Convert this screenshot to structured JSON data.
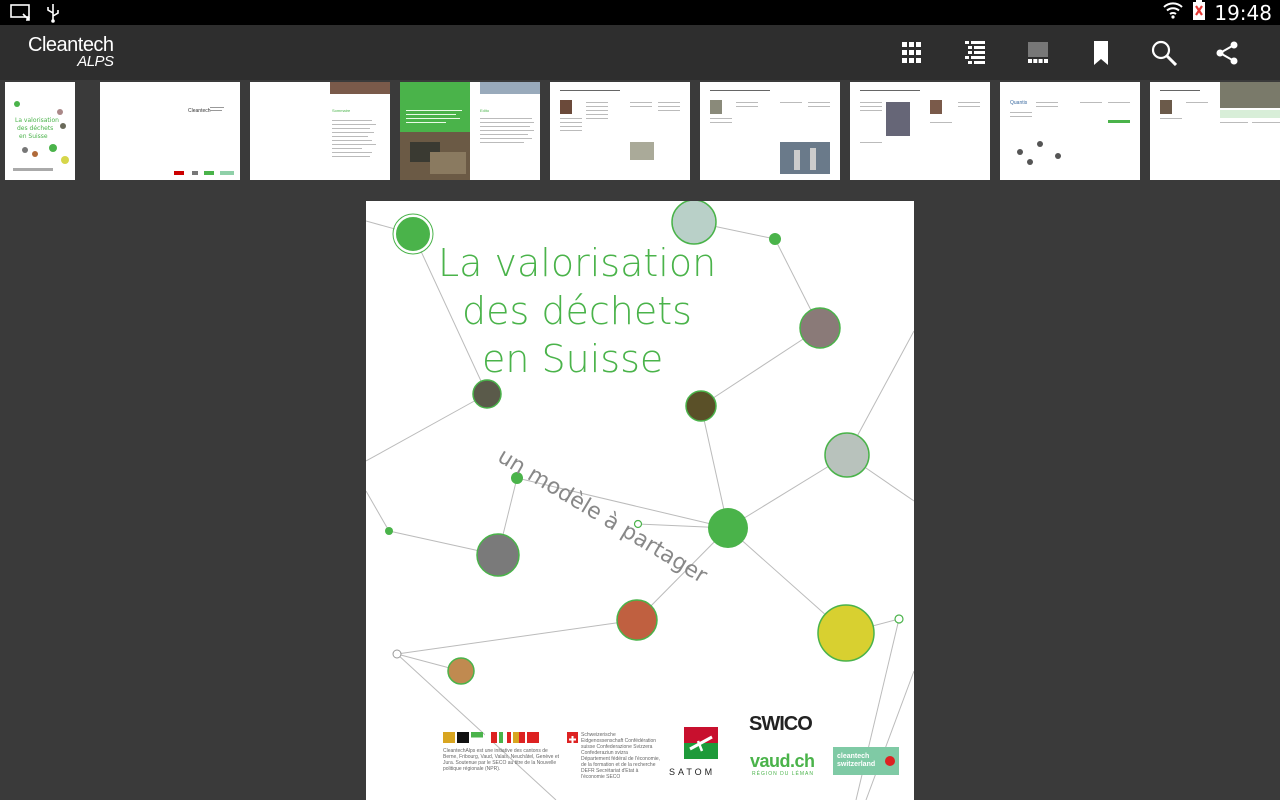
{
  "status": {
    "time": "19:48"
  },
  "app": {
    "logo_line1": "Cleantech",
    "logo_line2": "ALPS",
    "actions": [
      {
        "name": "grid-view-icon"
      },
      {
        "name": "outline-list-icon"
      },
      {
        "name": "page-layout-icon"
      },
      {
        "name": "bookmark-icon"
      },
      {
        "name": "search-icon"
      },
      {
        "name": "share-icon"
      }
    ]
  },
  "document": {
    "title_line1": "La valorisation",
    "title_line2": "des déchets",
    "title_line3": "en Suisse",
    "subtitle": "un modèle à partager",
    "footer": {
      "initiative": "CleantechAlps est une initiative des cantons de Berne, Fribourg, Vaud, Valais, Neuchâtel, Genève et Jura. Soutenue par le SECO au titre de la Nouvelle politique régionale (NPR).",
      "confed": "Schweizerische Eidgenossenschaft Confédération suisse Confederazione Svizzera Confederaziun svizra",
      "dept": "Département fédéral de l'économie, de la formation et de la recherche DEFR Secrétariat d'Etat à l'économie SECO",
      "satom": "SATOM",
      "swico": "SWICO",
      "vaud": "vaud.ch",
      "vaud_sub": "RÉGION DU LÉMAN",
      "cleantech_ch": "cleantech switzerland"
    }
  },
  "colors": {
    "accent": "#4ab34a",
    "appbar": "#2e2e2e",
    "background": "#3a3a3a"
  }
}
